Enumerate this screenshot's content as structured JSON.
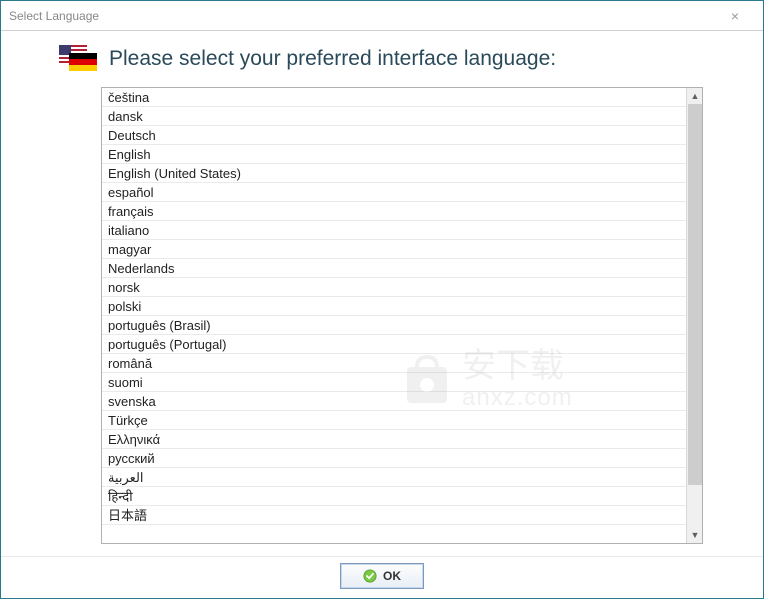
{
  "window": {
    "title": "Select Language",
    "close_label": "×"
  },
  "header": {
    "text": "Please select your preferred interface language:"
  },
  "languages": [
    "čeština",
    "dansk",
    "Deutsch",
    "English",
    "English (United States)",
    "español",
    "français",
    "italiano",
    "magyar",
    "Nederlands",
    "norsk",
    "polski",
    "português (Brasil)",
    "português (Portugal)",
    "română",
    "suomi",
    "svenska",
    "Türkçe",
    "Ελληνικά",
    "русский",
    "العربية",
    "हिन्दी",
    "日本語"
  ],
  "footer": {
    "ok_label": "OK"
  },
  "watermark": {
    "chinese": "安下载",
    "domain": "anxz.com"
  }
}
